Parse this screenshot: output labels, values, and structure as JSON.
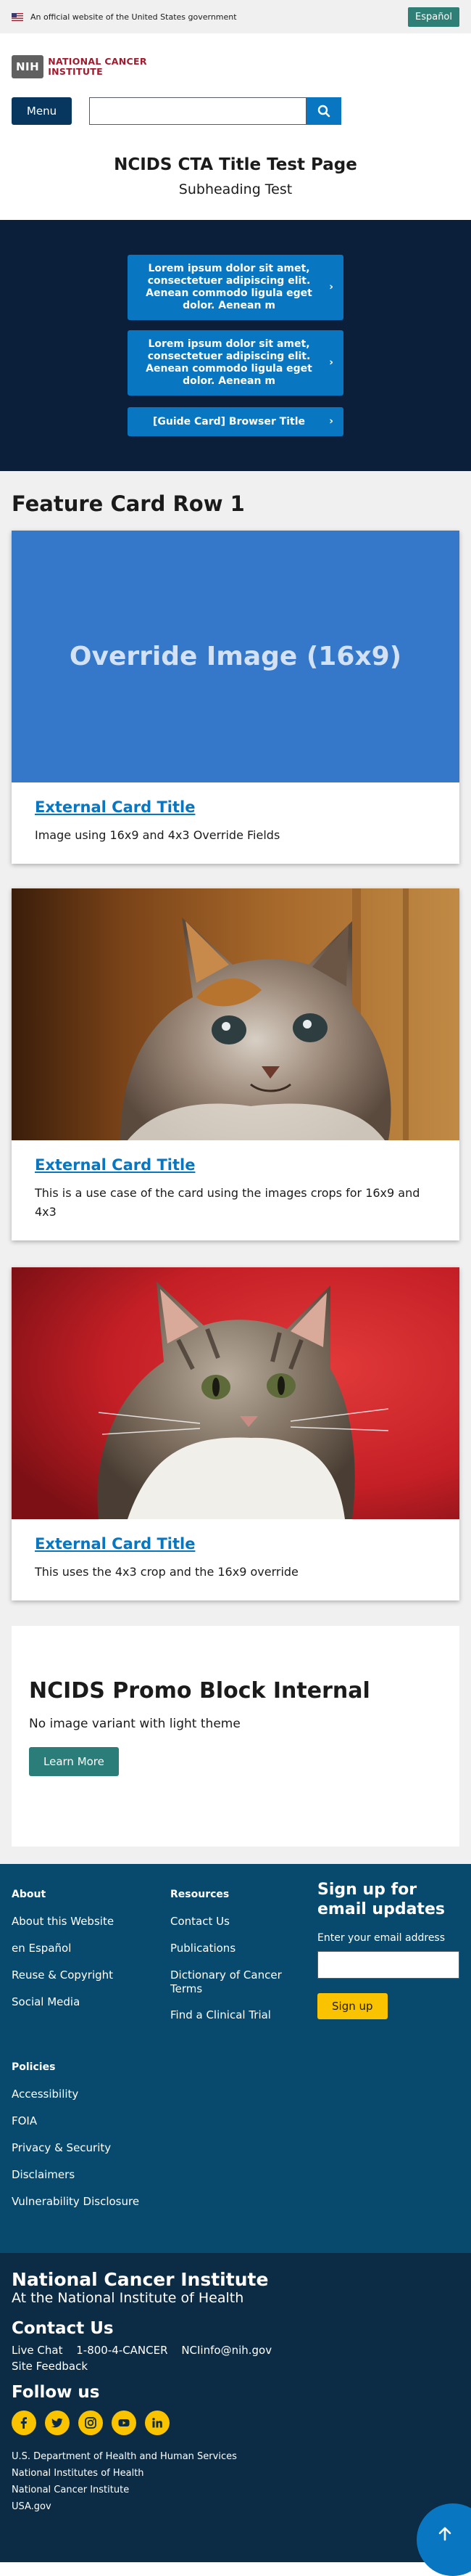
{
  "gov_banner": {
    "text": "An official website of the United States government",
    "language_button": "Español"
  },
  "header": {
    "logo_badge": "NIH",
    "logo_line1": "NATIONAL CANCER",
    "logo_line2": "INSTITUTE",
    "menu_label": "Menu",
    "search_placeholder": ""
  },
  "page": {
    "title": "NCIDS CTA Title Test Page",
    "subtitle": "Subheading Test"
  },
  "cta": {
    "buttons": [
      {
        "label": "Lorem ipsum dolor sit amet, consectetuer adipiscing elit. Aenean commodo ligula eget dolor. Aenean m"
      },
      {
        "label": "Lorem ipsum dolor sit amet, consectetuer adipiscing elit. Aenean commodo ligula eget dolor. Aenean m"
      },
      {
        "label": "[Guide Card] Browser Title"
      }
    ],
    "chevron": "›"
  },
  "feature_row": {
    "title": "Feature Card Row 1",
    "cards": [
      {
        "title": "External Card Title",
        "description": "Image using 16x9 and 4x3 Override Fields",
        "image_text": "Override Image (16x9)"
      },
      {
        "title": "External Card Title",
        "description": "This is a use case of the card using the images crops for 16x9 and 4x3"
      },
      {
        "title": "External Card Title",
        "description": "This uses the 4x3 crop and the 16x9 override"
      }
    ]
  },
  "promo": {
    "title": "NCIDS Promo Block Internal",
    "description": "No image variant with light theme",
    "button": "Learn More"
  },
  "footer": {
    "about": {
      "title": "About",
      "links": [
        "About this Website",
        "en Español",
        "Reuse & Copyright",
        "Social Media"
      ]
    },
    "resources": {
      "title": "Resources",
      "links": [
        "Contact Us",
        "Publications",
        "Dictionary of Cancer Terms",
        "Find a Clinical Trial"
      ]
    },
    "policies": {
      "title": "Policies",
      "links": [
        "Accessibility",
        "FOIA",
        "Privacy & Security",
        "Disclaimers",
        "Vulnerability Disclosure"
      ]
    },
    "signup": {
      "title": "Sign up for email updates",
      "label": "Enter your email address",
      "button": "Sign up"
    }
  },
  "bottom_footer": {
    "org_name": "National Cancer Institute",
    "org_sub": "At the National Institute of Health",
    "contact_title": "Contact Us",
    "live_chat": "Live Chat",
    "phone": "1-800-4-CANCER",
    "email": "NCIinfo@nih.gov",
    "site_feedback": "Site Feedback",
    "follow_title": "Follow us",
    "agencies": [
      "U.S. Department of Health and Human Services",
      "National Institutes of Health",
      "National Cancer Institute",
      "USA.gov"
    ]
  },
  "colors": {
    "accent": "#0876c0",
    "navy": "#07375e",
    "cta_bg": "#0b1e3a",
    "footer": "#084a6e",
    "bottom_footer": "#0c2c45",
    "yellow": "#fac300",
    "teal": "#2a7d78"
  }
}
